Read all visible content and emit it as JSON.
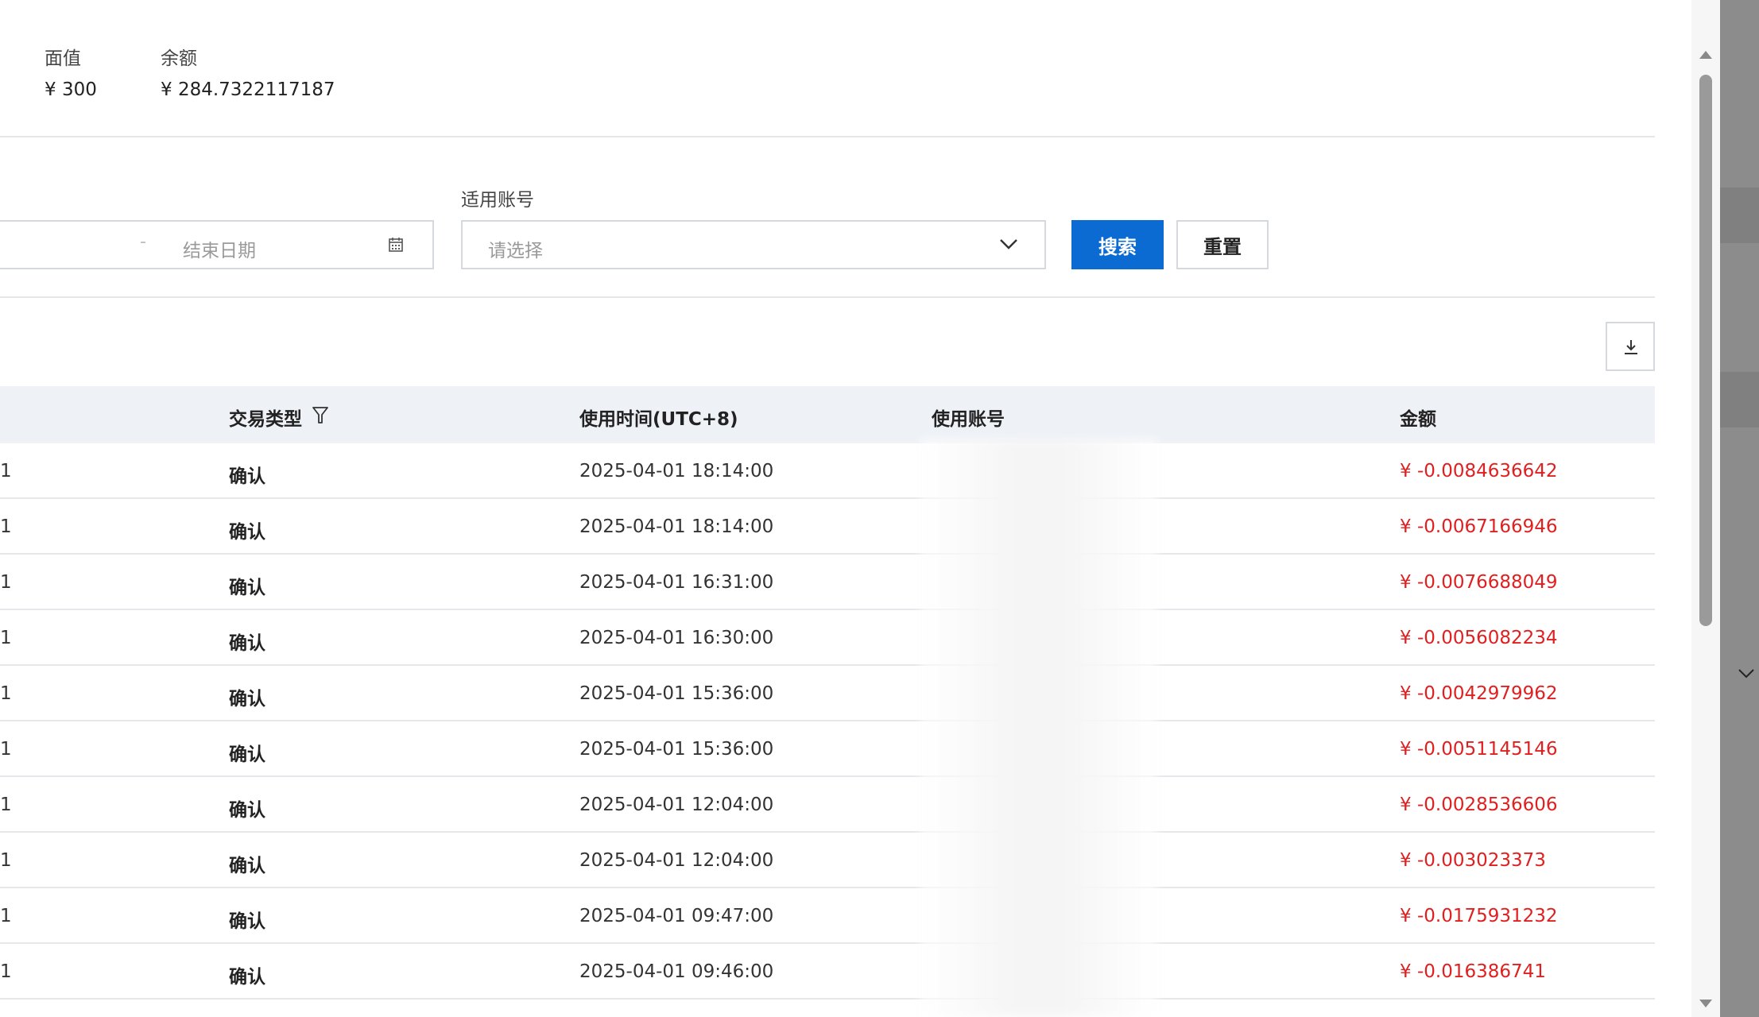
{
  "summary": {
    "face_value_label": "面值",
    "face_value": "¥ 300",
    "balance_label": "余额",
    "balance": "¥ 284.7322117187"
  },
  "filters": {
    "date_end_placeholder": "结束日期",
    "date_separator": "-",
    "account_label": "适用账号",
    "account_placeholder": "请选择",
    "search_label": "搜索",
    "reset_label": "重置"
  },
  "table": {
    "columns": {
      "type": "交易类型",
      "time": "使用时间(UTC+8)",
      "account": "使用账号",
      "amount": "金额"
    },
    "rows": [
      {
        "id": "1",
        "type": "确认",
        "time": "2025-04-01 18:14:00",
        "amount": "¥ -0.0084636642"
      },
      {
        "id": "1",
        "type": "确认",
        "time": "2025-04-01 18:14:00",
        "amount": "¥ -0.0067166946"
      },
      {
        "id": "1",
        "type": "确认",
        "time": "2025-04-01 16:31:00",
        "amount": "¥ -0.0076688049"
      },
      {
        "id": "1",
        "type": "确认",
        "time": "2025-04-01 16:30:00",
        "amount": "¥ -0.0056082234"
      },
      {
        "id": "1",
        "type": "确认",
        "time": "2025-04-01 15:36:00",
        "amount": "¥ -0.0042979962"
      },
      {
        "id": "1",
        "type": "确认",
        "time": "2025-04-01 15:36:00",
        "amount": "¥ -0.0051145146"
      },
      {
        "id": "1",
        "type": "确认",
        "time": "2025-04-01 12:04:00",
        "amount": "¥ -0.0028536606"
      },
      {
        "id": "1",
        "type": "确认",
        "time": "2025-04-01 12:04:00",
        "amount": "¥ -0.003023373"
      },
      {
        "id": "1",
        "type": "确认",
        "time": "2025-04-01 09:47:00",
        "amount": "¥ -0.0175931232"
      },
      {
        "id": "1",
        "type": "确认",
        "time": "2025-04-01 09:46:00",
        "amount": "¥ -0.016386741"
      }
    ]
  },
  "colors": {
    "primary": "#0b6bd3",
    "negative_amount": "#e02020",
    "header_bg": "#eef2f7"
  },
  "icons": {
    "calendar": "calendar-icon",
    "chevron": "chevron-down-icon",
    "filter": "filter-icon",
    "download": "download-icon"
  }
}
